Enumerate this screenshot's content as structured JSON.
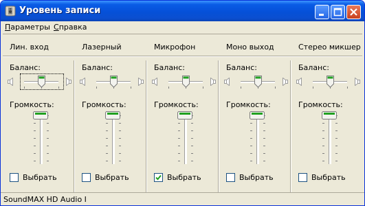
{
  "window": {
    "title": "Уровень записи"
  },
  "menu": {
    "items": [
      {
        "label_first": "П",
        "label_rest": "араметры"
      },
      {
        "label_first": "С",
        "label_rest": "правка"
      }
    ]
  },
  "labels": {
    "balance": "Баланс:",
    "volume": "Громкость:",
    "select": "Выбрать"
  },
  "channels": [
    {
      "name": "Лин. вход",
      "balance": 0.5,
      "volume": 1.0,
      "selected": false,
      "focused": true
    },
    {
      "name": "Лазерный",
      "balance": 0.5,
      "volume": 1.0,
      "selected": false,
      "focused": false
    },
    {
      "name": "Микрофон",
      "balance": 0.5,
      "volume": 1.0,
      "selected": true,
      "focused": false
    },
    {
      "name": "Моно выход",
      "balance": 0.5,
      "volume": 1.0,
      "selected": false,
      "focused": false
    },
    {
      "name": "Стерео микшер",
      "balance": 0.5,
      "volume": 1.0,
      "selected": false,
      "focused": false
    }
  ],
  "status": {
    "device": "SoundMAX HD Audio I"
  },
  "colors": {
    "titlebar": "#0a5ce6",
    "face": "#ece9d8",
    "accent_green": "#21a121"
  },
  "icons": {
    "app": "speaker-icon",
    "minimize": "minimize-icon",
    "maximize": "maximize-icon",
    "close": "close-icon"
  }
}
